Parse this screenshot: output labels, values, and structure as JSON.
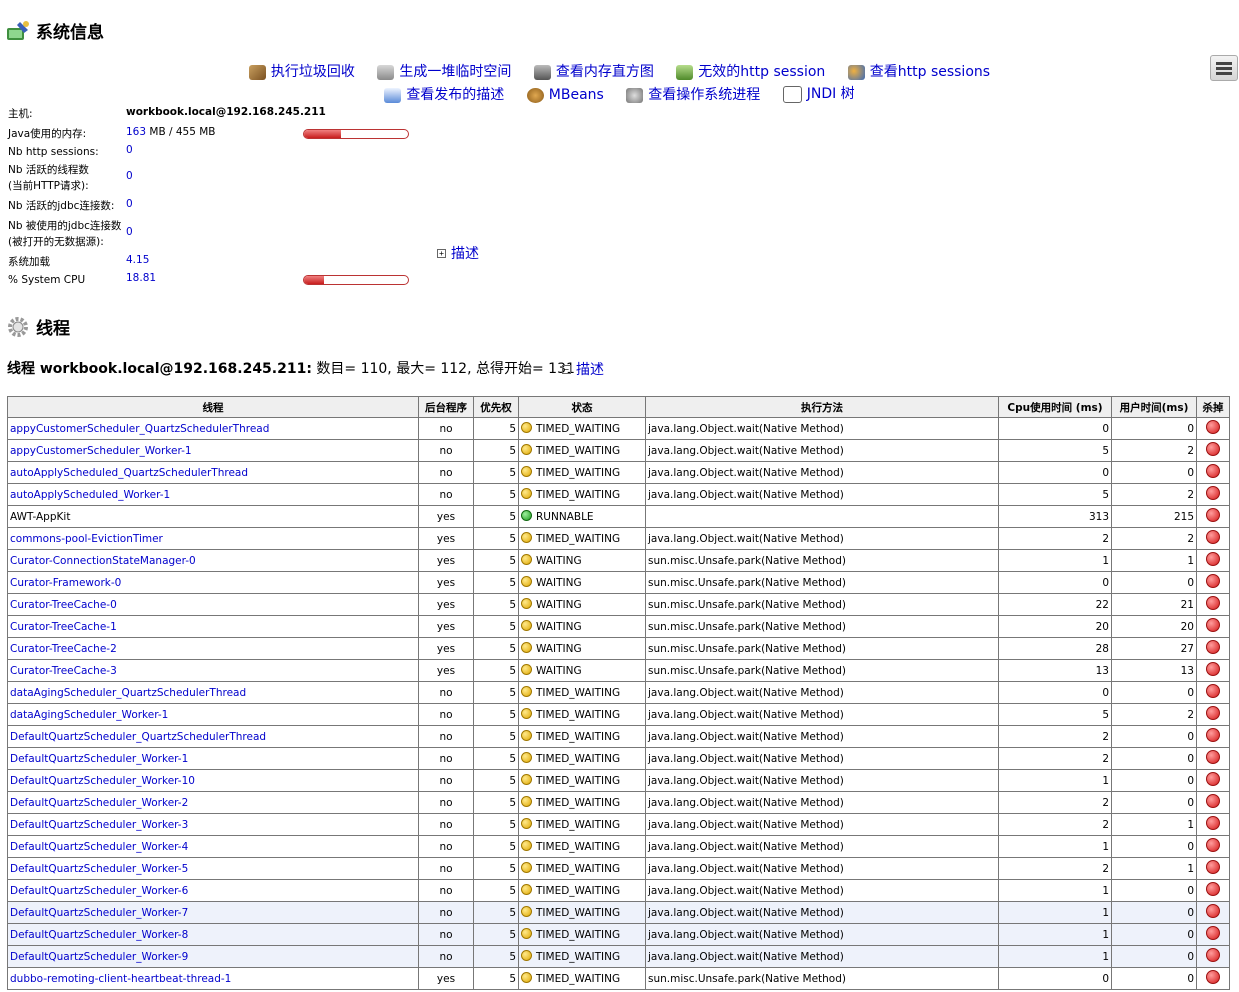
{
  "system": {
    "title": "系统信息",
    "actions_row1": [
      "执行垃圾回收",
      "生成一堆临时空间",
      "查看内存直方图",
      "无效的http session",
      "查看http sessions"
    ],
    "actions_row2": [
      "查看发布的描述",
      "MBeans",
      "查看操作系统进程",
      "JNDI 树"
    ],
    "host_label": "主机:",
    "host_value": "workbook.local@192.168.245.211",
    "memory_label": "Java使用的内存:",
    "memory_used": "163",
    "memory_rest": " MB / 455 MB",
    "memory_fraction": 0.36,
    "sessions_label": "Nb http sessions:",
    "sessions_value": "0",
    "active_threads_label1": "Nb 活跃的线程数",
    "active_threads_label2": "(当前HTTP请求):",
    "active_threads_value": "0",
    "active_jdbc_label": "Nb 活跃的jdbc连接数:",
    "active_jdbc_value": "0",
    "used_jdbc_label1": "Nb 被使用的jdbc连接数",
    "used_jdbc_label2": "(被打开的无数据源):",
    "used_jdbc_value": "0",
    "load_label": "系统加载",
    "load_value": "4.15",
    "cpu_label": "% System CPU",
    "cpu_value": "18.81",
    "cpu_fraction": 0.1881,
    "describe_label": "描述"
  },
  "threads": {
    "title": "线程",
    "summary_bold": "线程 workbook.local@192.168.245.211:",
    "summary_rest": " 数目= 110, 最大= 112, 总得开始= 131",
    "describe_label": "描述",
    "columns": [
      "线程",
      "后台程序",
      "优先权",
      "状态",
      "执行方法",
      "Cpu使用时间 (ms)",
      "用户时间(ms)",
      "杀掉"
    ],
    "rows": [
      {
        "name": "appyCustomerScheduler_QuartzSchedulerThread",
        "daemon": "no",
        "priority": "5",
        "state": "TIMED_WAITING",
        "method": "java.lang.Object.wait(Native Method)",
        "cpu": "0",
        "user": "0",
        "link": true,
        "hl": false
      },
      {
        "name": "appyCustomerScheduler_Worker-1",
        "daemon": "no",
        "priority": "5",
        "state": "TIMED_WAITING",
        "method": "java.lang.Object.wait(Native Method)",
        "cpu": "5",
        "user": "2",
        "link": true,
        "hl": false
      },
      {
        "name": "autoApplyScheduled_QuartzSchedulerThread",
        "daemon": "no",
        "priority": "5",
        "state": "TIMED_WAITING",
        "method": "java.lang.Object.wait(Native Method)",
        "cpu": "0",
        "user": "0",
        "link": true,
        "hl": false
      },
      {
        "name": "autoApplyScheduled_Worker-1",
        "daemon": "no",
        "priority": "5",
        "state": "TIMED_WAITING",
        "method": "java.lang.Object.wait(Native Method)",
        "cpu": "5",
        "user": "2",
        "link": true,
        "hl": false
      },
      {
        "name": "AWT-AppKit",
        "daemon": "yes",
        "priority": "5",
        "state": "RUNNABLE",
        "method": "",
        "cpu": "313",
        "user": "215",
        "link": false,
        "hl": false
      },
      {
        "name": "commons-pool-EvictionTimer",
        "daemon": "yes",
        "priority": "5",
        "state": "TIMED_WAITING",
        "method": "java.lang.Object.wait(Native Method)",
        "cpu": "2",
        "user": "2",
        "link": true,
        "hl": false
      },
      {
        "name": "Curator-ConnectionStateManager-0",
        "daemon": "yes",
        "priority": "5",
        "state": "WAITING",
        "method": "sun.misc.Unsafe.park(Native Method)",
        "cpu": "1",
        "user": "1",
        "link": true,
        "hl": false
      },
      {
        "name": "Curator-Framework-0",
        "daemon": "yes",
        "priority": "5",
        "state": "WAITING",
        "method": "sun.misc.Unsafe.park(Native Method)",
        "cpu": "0",
        "user": "0",
        "link": true,
        "hl": false
      },
      {
        "name": "Curator-TreeCache-0",
        "daemon": "yes",
        "priority": "5",
        "state": "WAITING",
        "method": "sun.misc.Unsafe.park(Native Method)",
        "cpu": "22",
        "user": "21",
        "link": true,
        "hl": false
      },
      {
        "name": "Curator-TreeCache-1",
        "daemon": "yes",
        "priority": "5",
        "state": "WAITING",
        "method": "sun.misc.Unsafe.park(Native Method)",
        "cpu": "20",
        "user": "20",
        "link": true,
        "hl": false
      },
      {
        "name": "Curator-TreeCache-2",
        "daemon": "yes",
        "priority": "5",
        "state": "WAITING",
        "method": "sun.misc.Unsafe.park(Native Method)",
        "cpu": "28",
        "user": "27",
        "link": true,
        "hl": false
      },
      {
        "name": "Curator-TreeCache-3",
        "daemon": "yes",
        "priority": "5",
        "state": "WAITING",
        "method": "sun.misc.Unsafe.park(Native Method)",
        "cpu": "13",
        "user": "13",
        "link": true,
        "hl": false
      },
      {
        "name": "dataAgingScheduler_QuartzSchedulerThread",
        "daemon": "no",
        "priority": "5",
        "state": "TIMED_WAITING",
        "method": "java.lang.Object.wait(Native Method)",
        "cpu": "0",
        "user": "0",
        "link": true,
        "hl": false
      },
      {
        "name": "dataAgingScheduler_Worker-1",
        "daemon": "no",
        "priority": "5",
        "state": "TIMED_WAITING",
        "method": "java.lang.Object.wait(Native Method)",
        "cpu": "5",
        "user": "2",
        "link": true,
        "hl": false
      },
      {
        "name": "DefaultQuartzScheduler_QuartzSchedulerThread",
        "daemon": "no",
        "priority": "5",
        "state": "TIMED_WAITING",
        "method": "java.lang.Object.wait(Native Method)",
        "cpu": "2",
        "user": "0",
        "link": true,
        "hl": false
      },
      {
        "name": "DefaultQuartzScheduler_Worker-1",
        "daemon": "no",
        "priority": "5",
        "state": "TIMED_WAITING",
        "method": "java.lang.Object.wait(Native Method)",
        "cpu": "2",
        "user": "0",
        "link": true,
        "hl": false
      },
      {
        "name": "DefaultQuartzScheduler_Worker-10",
        "daemon": "no",
        "priority": "5",
        "state": "TIMED_WAITING",
        "method": "java.lang.Object.wait(Native Method)",
        "cpu": "1",
        "user": "0",
        "link": true,
        "hl": false
      },
      {
        "name": "DefaultQuartzScheduler_Worker-2",
        "daemon": "no",
        "priority": "5",
        "state": "TIMED_WAITING",
        "method": "java.lang.Object.wait(Native Method)",
        "cpu": "2",
        "user": "0",
        "link": true,
        "hl": false
      },
      {
        "name": "DefaultQuartzScheduler_Worker-3",
        "daemon": "no",
        "priority": "5",
        "state": "TIMED_WAITING",
        "method": "java.lang.Object.wait(Native Method)",
        "cpu": "2",
        "user": "1",
        "link": true,
        "hl": false
      },
      {
        "name": "DefaultQuartzScheduler_Worker-4",
        "daemon": "no",
        "priority": "5",
        "state": "TIMED_WAITING",
        "method": "java.lang.Object.wait(Native Method)",
        "cpu": "1",
        "user": "0",
        "link": true,
        "hl": false
      },
      {
        "name": "DefaultQuartzScheduler_Worker-5",
        "daemon": "no",
        "priority": "5",
        "state": "TIMED_WAITING",
        "method": "java.lang.Object.wait(Native Method)",
        "cpu": "2",
        "user": "1",
        "link": true,
        "hl": false
      },
      {
        "name": "DefaultQuartzScheduler_Worker-6",
        "daemon": "no",
        "priority": "5",
        "state": "TIMED_WAITING",
        "method": "java.lang.Object.wait(Native Method)",
        "cpu": "1",
        "user": "0",
        "link": true,
        "hl": false
      },
      {
        "name": "DefaultQuartzScheduler_Worker-7",
        "daemon": "no",
        "priority": "5",
        "state": "TIMED_WAITING",
        "method": "java.lang.Object.wait(Native Method)",
        "cpu": "1",
        "user": "0",
        "link": true,
        "hl": true
      },
      {
        "name": "DefaultQuartzScheduler_Worker-8",
        "daemon": "no",
        "priority": "5",
        "state": "TIMED_WAITING",
        "method": "java.lang.Object.wait(Native Method)",
        "cpu": "1",
        "user": "0",
        "link": true,
        "hl": true
      },
      {
        "name": "DefaultQuartzScheduler_Worker-9",
        "daemon": "no",
        "priority": "5",
        "state": "TIMED_WAITING",
        "method": "java.lang.Object.wait(Native Method)",
        "cpu": "1",
        "user": "0",
        "link": true,
        "hl": true
      },
      {
        "name": "dubbo-remoting-client-heartbeat-thread-1",
        "daemon": "yes",
        "priority": "5",
        "state": "TIMED_WAITING",
        "method": "sun.misc.Unsafe.park(Native Method)",
        "cpu": "0",
        "user": "0",
        "link": true,
        "hl": false
      }
    ]
  }
}
